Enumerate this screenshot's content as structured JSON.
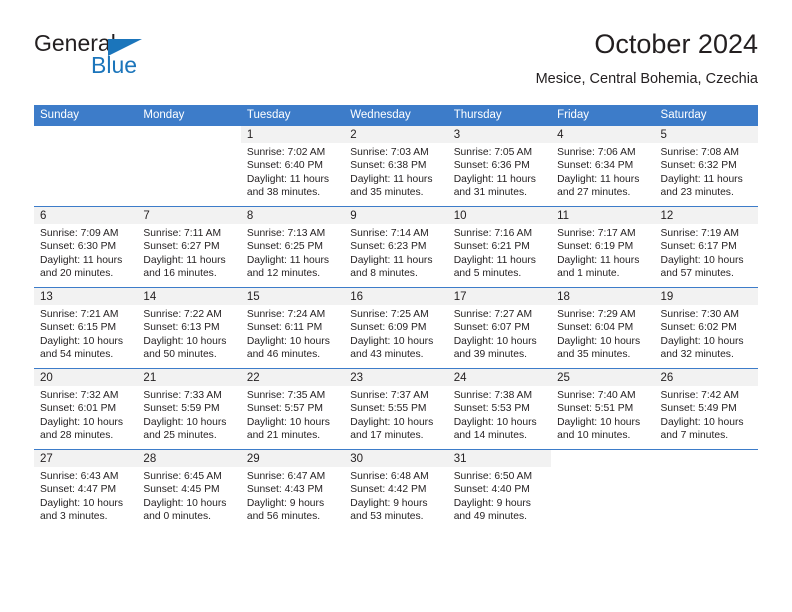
{
  "brand": {
    "name_top": "General",
    "name_bottom": "Blue",
    "accent_color": "#1b75bb",
    "triangle_icon": "brand-triangle-icon"
  },
  "header": {
    "title": "October 2024",
    "subtitle": "Mesice, Central Bohemia, Czechia"
  },
  "theme": {
    "header_blue": "#3d7cc9",
    "date_band_gray": "#f2f2f2",
    "text_color": "#231f20"
  },
  "calendar": {
    "weekday_headers": [
      "Sunday",
      "Monday",
      "Tuesday",
      "Wednesday",
      "Thursday",
      "Friday",
      "Saturday"
    ],
    "weeks": [
      [
        {
          "day": "",
          "blank": true
        },
        {
          "day": "",
          "blank": true
        },
        {
          "day": "1",
          "sunrise": "Sunrise: 7:02 AM",
          "sunset": "Sunset: 6:40 PM",
          "daylight": "Daylight: 11 hours and 38 minutes."
        },
        {
          "day": "2",
          "sunrise": "Sunrise: 7:03 AM",
          "sunset": "Sunset: 6:38 PM",
          "daylight": "Daylight: 11 hours and 35 minutes."
        },
        {
          "day": "3",
          "sunrise": "Sunrise: 7:05 AM",
          "sunset": "Sunset: 6:36 PM",
          "daylight": "Daylight: 11 hours and 31 minutes."
        },
        {
          "day": "4",
          "sunrise": "Sunrise: 7:06 AM",
          "sunset": "Sunset: 6:34 PM",
          "daylight": "Daylight: 11 hours and 27 minutes."
        },
        {
          "day": "5",
          "sunrise": "Sunrise: 7:08 AM",
          "sunset": "Sunset: 6:32 PM",
          "daylight": "Daylight: 11 hours and 23 minutes."
        }
      ],
      [
        {
          "day": "6",
          "sunrise": "Sunrise: 7:09 AM",
          "sunset": "Sunset: 6:30 PM",
          "daylight": "Daylight: 11 hours and 20 minutes."
        },
        {
          "day": "7",
          "sunrise": "Sunrise: 7:11 AM",
          "sunset": "Sunset: 6:27 PM",
          "daylight": "Daylight: 11 hours and 16 minutes."
        },
        {
          "day": "8",
          "sunrise": "Sunrise: 7:13 AM",
          "sunset": "Sunset: 6:25 PM",
          "daylight": "Daylight: 11 hours and 12 minutes."
        },
        {
          "day": "9",
          "sunrise": "Sunrise: 7:14 AM",
          "sunset": "Sunset: 6:23 PM",
          "daylight": "Daylight: 11 hours and 8 minutes."
        },
        {
          "day": "10",
          "sunrise": "Sunrise: 7:16 AM",
          "sunset": "Sunset: 6:21 PM",
          "daylight": "Daylight: 11 hours and 5 minutes."
        },
        {
          "day": "11",
          "sunrise": "Sunrise: 7:17 AM",
          "sunset": "Sunset: 6:19 PM",
          "daylight": "Daylight: 11 hours and 1 minute."
        },
        {
          "day": "12",
          "sunrise": "Sunrise: 7:19 AM",
          "sunset": "Sunset: 6:17 PM",
          "daylight": "Daylight: 10 hours and 57 minutes."
        }
      ],
      [
        {
          "day": "13",
          "sunrise": "Sunrise: 7:21 AM",
          "sunset": "Sunset: 6:15 PM",
          "daylight": "Daylight: 10 hours and 54 minutes."
        },
        {
          "day": "14",
          "sunrise": "Sunrise: 7:22 AM",
          "sunset": "Sunset: 6:13 PM",
          "daylight": "Daylight: 10 hours and 50 minutes."
        },
        {
          "day": "15",
          "sunrise": "Sunrise: 7:24 AM",
          "sunset": "Sunset: 6:11 PM",
          "daylight": "Daylight: 10 hours and 46 minutes."
        },
        {
          "day": "16",
          "sunrise": "Sunrise: 7:25 AM",
          "sunset": "Sunset: 6:09 PM",
          "daylight": "Daylight: 10 hours and 43 minutes."
        },
        {
          "day": "17",
          "sunrise": "Sunrise: 7:27 AM",
          "sunset": "Sunset: 6:07 PM",
          "daylight": "Daylight: 10 hours and 39 minutes."
        },
        {
          "day": "18",
          "sunrise": "Sunrise: 7:29 AM",
          "sunset": "Sunset: 6:04 PM",
          "daylight": "Daylight: 10 hours and 35 minutes."
        },
        {
          "day": "19",
          "sunrise": "Sunrise: 7:30 AM",
          "sunset": "Sunset: 6:02 PM",
          "daylight": "Daylight: 10 hours and 32 minutes."
        }
      ],
      [
        {
          "day": "20",
          "sunrise": "Sunrise: 7:32 AM",
          "sunset": "Sunset: 6:01 PM",
          "daylight": "Daylight: 10 hours and 28 minutes."
        },
        {
          "day": "21",
          "sunrise": "Sunrise: 7:33 AM",
          "sunset": "Sunset: 5:59 PM",
          "daylight": "Daylight: 10 hours and 25 minutes."
        },
        {
          "day": "22",
          "sunrise": "Sunrise: 7:35 AM",
          "sunset": "Sunset: 5:57 PM",
          "daylight": "Daylight: 10 hours and 21 minutes."
        },
        {
          "day": "23",
          "sunrise": "Sunrise: 7:37 AM",
          "sunset": "Sunset: 5:55 PM",
          "daylight": "Daylight: 10 hours and 17 minutes."
        },
        {
          "day": "24",
          "sunrise": "Sunrise: 7:38 AM",
          "sunset": "Sunset: 5:53 PM",
          "daylight": "Daylight: 10 hours and 14 minutes."
        },
        {
          "day": "25",
          "sunrise": "Sunrise: 7:40 AM",
          "sunset": "Sunset: 5:51 PM",
          "daylight": "Daylight: 10 hours and 10 minutes."
        },
        {
          "day": "26",
          "sunrise": "Sunrise: 7:42 AM",
          "sunset": "Sunset: 5:49 PM",
          "daylight": "Daylight: 10 hours and 7 minutes."
        }
      ],
      [
        {
          "day": "27",
          "sunrise": "Sunrise: 6:43 AM",
          "sunset": "Sunset: 4:47 PM",
          "daylight": "Daylight: 10 hours and 3 minutes."
        },
        {
          "day": "28",
          "sunrise": "Sunrise: 6:45 AM",
          "sunset": "Sunset: 4:45 PM",
          "daylight": "Daylight: 10 hours and 0 minutes."
        },
        {
          "day": "29",
          "sunrise": "Sunrise: 6:47 AM",
          "sunset": "Sunset: 4:43 PM",
          "daylight": "Daylight: 9 hours and 56 minutes."
        },
        {
          "day": "30",
          "sunrise": "Sunrise: 6:48 AM",
          "sunset": "Sunset: 4:42 PM",
          "daylight": "Daylight: 9 hours and 53 minutes."
        },
        {
          "day": "31",
          "sunrise": "Sunrise: 6:50 AM",
          "sunset": "Sunset: 4:40 PM",
          "daylight": "Daylight: 9 hours and 49 minutes."
        },
        {
          "day": "",
          "blank": true
        },
        {
          "day": "",
          "blank": true
        }
      ]
    ]
  }
}
